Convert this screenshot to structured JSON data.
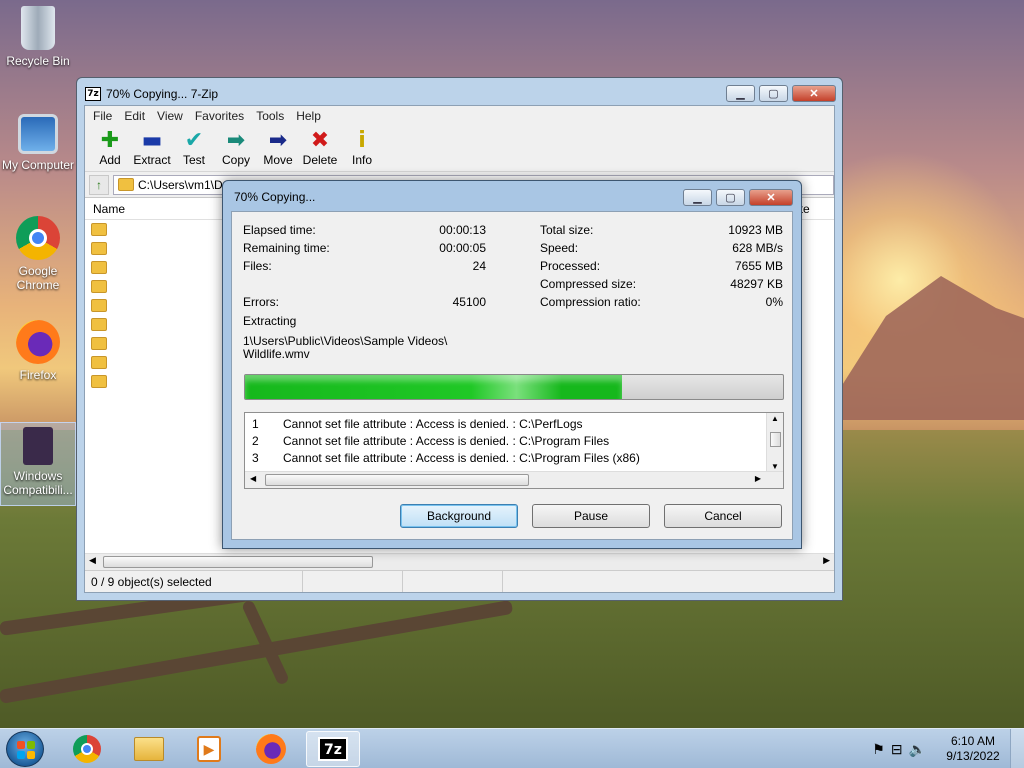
{
  "desktop": {
    "icons": [
      {
        "label": "Recycle Bin"
      },
      {
        "label": "My Computer"
      },
      {
        "label": "Google Chrome"
      },
      {
        "label": "Firefox"
      },
      {
        "label": "Windows Compatibili..."
      }
    ]
  },
  "main_window": {
    "title": "70% Copying... 7-Zip",
    "app_icon_text": "7z",
    "menu": [
      "File",
      "Edit",
      "View",
      "Favorites",
      "Tools",
      "Help"
    ],
    "toolbar": [
      {
        "label": "Add",
        "icon": "plus-icon",
        "glyph": "✚",
        "color": "#1a9a1a"
      },
      {
        "label": "Extract",
        "icon": "minus-icon",
        "glyph": "▬",
        "color": "#1a3aa8"
      },
      {
        "label": "Test",
        "icon": "check-icon",
        "glyph": "✔",
        "color": "#1aa8a8"
      },
      {
        "label": "Copy",
        "icon": "copy-arrow-icon",
        "glyph": "➡",
        "color": "#1a8a7a"
      },
      {
        "label": "Move",
        "icon": "move-arrow-icon",
        "glyph": "➡",
        "color": "#1a2a8a"
      },
      {
        "label": "Delete",
        "icon": "delete-x-icon",
        "glyph": "✖",
        "color": "#d01a1a"
      },
      {
        "label": "Info",
        "icon": "info-icon",
        "glyph": "i",
        "color": "#c8a800"
      }
    ],
    "address": "C:\\Users\\vm1\\D",
    "columns": [
      "Name",
      "ttribute"
    ],
    "folder_rows": 9,
    "status": {
      "selected": "0 / 9 object(s) selected"
    }
  },
  "dialog": {
    "title": "70% Copying...",
    "left": [
      {
        "label": "Elapsed time:",
        "value": "00:00:13"
      },
      {
        "label": "Remaining time:",
        "value": "00:00:05"
      },
      {
        "label": "Files:",
        "value": "24"
      },
      {
        "label": "Errors:",
        "value": "45100"
      }
    ],
    "right": [
      {
        "label": "Total size:",
        "value": "10923 MB"
      },
      {
        "label": "Speed:",
        "value": "628 MB/s"
      },
      {
        "label": "Processed:",
        "value": "7655 MB"
      },
      {
        "label": "Compressed size:",
        "value": "48297 KB"
      },
      {
        "label": "Compression ratio:",
        "value": "0%"
      }
    ],
    "operation": "Extracting",
    "current_path_line1": "1\\Users\\Public\\Videos\\Sample Videos\\",
    "current_path_line2": "Wildlife.wmv",
    "progress": 0.7,
    "log": [
      {
        "num": "1",
        "text": "Cannot set file attribute : Access is denied. : C:\\PerfLogs"
      },
      {
        "num": "2",
        "text": "Cannot set file attribute : Access is denied. : C:\\Program Files"
      },
      {
        "num": "3",
        "text": "Cannot set file attribute : Access is denied. : C:\\Program Files (x86)"
      }
    ],
    "buttons": {
      "background": "Background",
      "pause": "Pause",
      "cancel": "Cancel"
    }
  },
  "taskbar": {
    "items": [
      "Google Chrome",
      "File Explorer",
      "Media Player",
      "Firefox",
      "7-Zip"
    ],
    "time": "6:10 AM",
    "date": "9/13/2022"
  }
}
